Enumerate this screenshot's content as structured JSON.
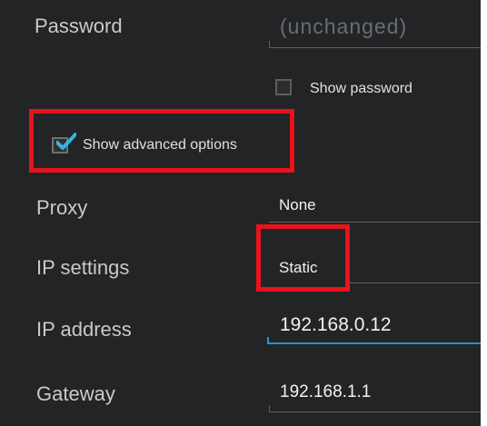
{
  "password": {
    "label": "Password",
    "placeholder": "(unchanged)"
  },
  "show_password": {
    "label": "Show password",
    "checked": false
  },
  "show_advanced": {
    "label": "Show advanced options",
    "checked": true
  },
  "proxy": {
    "label": "Proxy",
    "value": "None"
  },
  "ip_settings": {
    "label": "IP settings",
    "value": "Static"
  },
  "ip_address": {
    "label": "IP address",
    "value": "192.168.0.12"
  },
  "gateway": {
    "label": "Gateway",
    "value": "192.168.1.1"
  },
  "colors": {
    "background": "#222426",
    "accent": "#2f90c4",
    "highlight": "#e8131b",
    "checkmark": "#33b5e5"
  }
}
